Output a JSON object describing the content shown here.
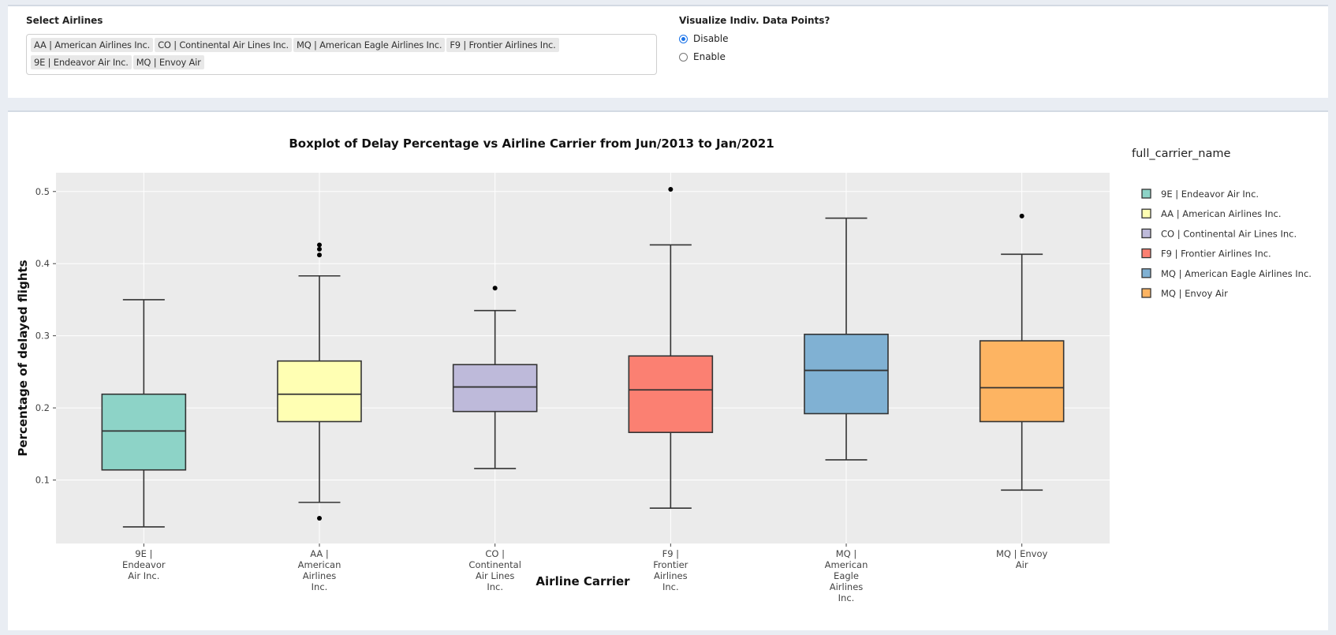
{
  "controls": {
    "select_label": "Select Airlines",
    "selected_airlines": [
      "AA | American Airlines Inc.",
      "CO | Continental Air Lines Inc.",
      "MQ | American Eagle Airlines Inc.",
      "F9 | Frontier Airlines Inc.",
      "9E | Endeavor Air Inc.",
      "MQ | Envoy Air"
    ],
    "points_label": "Visualize Indiv. Data Points?",
    "options": [
      {
        "label": "Disable",
        "checked": true
      },
      {
        "label": "Enable",
        "checked": false
      }
    ]
  },
  "chart_data": {
    "type": "box",
    "title": "Boxplot of Delay Percentage vs Airline Carrier from Jun/2013 to Jan/2021",
    "xlabel": "Airline Carrier",
    "ylabel": "Percentage of delayed flights",
    "legend_title": "full_carrier_name",
    "legend_position": "right",
    "ylim": [
      0.012,
      0.526
    ],
    "yticks": [
      "0.1",
      "0.2",
      "0.3",
      "0.4",
      "0.5"
    ],
    "yticks_values": [
      0.1,
      0.2,
      0.3,
      0.4,
      0.5
    ],
    "grid": true,
    "series": [
      {
        "name": "9E | Endeavor Air Inc.",
        "tick_label": [
          "9E |",
          "Endeavor",
          "Air Inc."
        ],
        "color": "#8dd3c7",
        "min": 0.035,
        "q1": 0.114,
        "median": 0.168,
        "q3": 0.219,
        "max": 0.35,
        "outliers": []
      },
      {
        "name": "AA | American Airlines Inc.",
        "tick_label": [
          "AA |",
          "American",
          "Airlines",
          "Inc."
        ],
        "color": "#ffffb3",
        "min": 0.069,
        "q1": 0.181,
        "median": 0.219,
        "q3": 0.265,
        "max": 0.383,
        "outliers": [
          0.047,
          0.412,
          0.42,
          0.426
        ]
      },
      {
        "name": "CO | Continental Air Lines Inc.",
        "tick_label": [
          "CO |",
          "Continental",
          "Air Lines",
          "Inc."
        ],
        "color": "#bebada",
        "min": 0.116,
        "q1": 0.195,
        "median": 0.229,
        "q3": 0.26,
        "max": 0.335,
        "outliers": [
          0.366
        ]
      },
      {
        "name": "F9 | Frontier Airlines Inc.",
        "tick_label": [
          "F9 |",
          "Frontier",
          "Airlines",
          "Inc."
        ],
        "color": "#fb8072",
        "min": 0.061,
        "q1": 0.166,
        "median": 0.225,
        "q3": 0.272,
        "max": 0.426,
        "outliers": [
          0.503
        ]
      },
      {
        "name": "MQ | American Eagle Airlines Inc.",
        "tick_label": [
          "MQ |",
          "American",
          "Eagle",
          "Airlines",
          "Inc."
        ],
        "color": "#80b1d3",
        "min": 0.128,
        "q1": 0.192,
        "median": 0.252,
        "q3": 0.302,
        "max": 0.463,
        "outliers": []
      },
      {
        "name": "MQ | Envoy Air",
        "tick_label": [
          "MQ | Envoy",
          "Air"
        ],
        "color": "#fdb462",
        "min": 0.086,
        "q1": 0.181,
        "median": 0.228,
        "q3": 0.293,
        "max": 0.413,
        "outliers": [
          0.466
        ]
      }
    ]
  }
}
